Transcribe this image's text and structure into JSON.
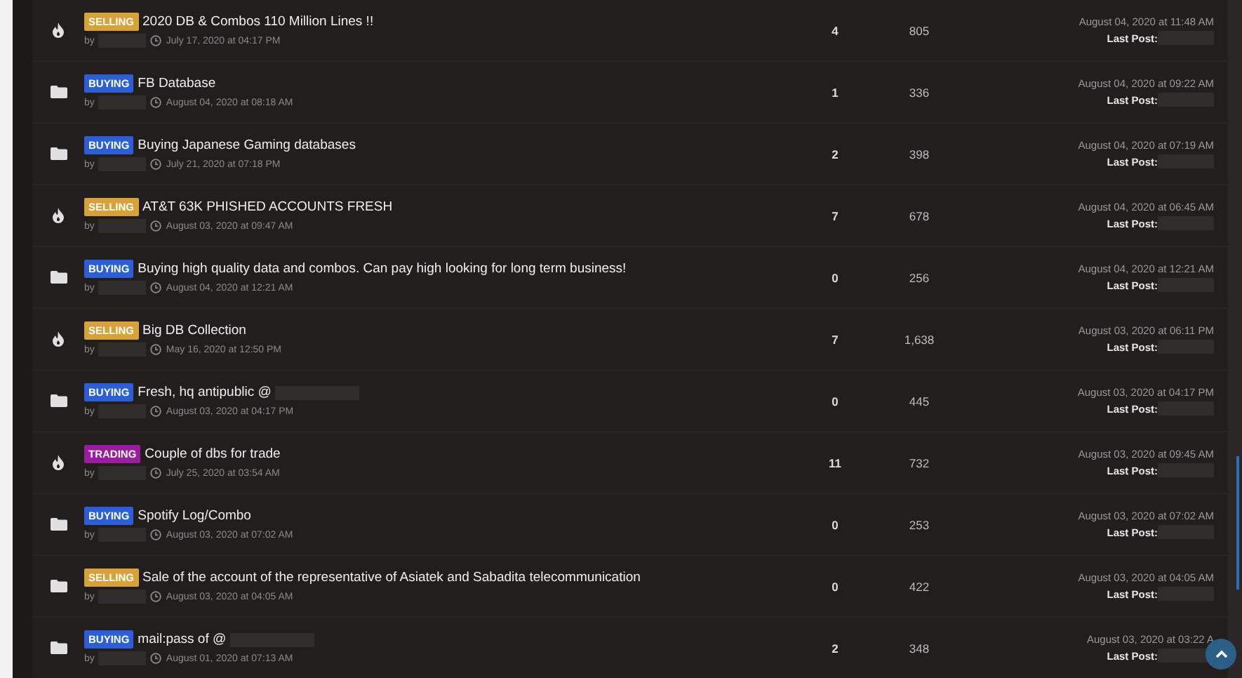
{
  "threads": [
    {
      "kind": "hot",
      "tag": {
        "text": "SELLING",
        "kind": "selling"
      },
      "title": "2020 DB & Combos 110 Million Lines !!",
      "title_redacted": false,
      "by": "by",
      "started": "July 17, 2020 at 04:17 PM",
      "replies": "4",
      "views": "805",
      "last_date": "August 04, 2020 at 11:48 AM",
      "last_label": "Last Post:"
    },
    {
      "kind": "normal",
      "tag": {
        "text": "BUYING",
        "kind": "buying"
      },
      "title": "FB Database",
      "title_redacted": false,
      "by": "by",
      "started": "August 04, 2020 at 08:18 AM",
      "replies": "1",
      "views": "336",
      "last_date": "August 04, 2020 at 09:22 AM",
      "last_label": "Last Post:"
    },
    {
      "kind": "normal",
      "tag": {
        "text": "BUYING",
        "kind": "buying"
      },
      "title": "Buying Japanese Gaming databases",
      "title_redacted": false,
      "by": "by",
      "started": "July 21, 2020 at 07:18 PM",
      "replies": "2",
      "views": "398",
      "last_date": "August 04, 2020 at 07:19 AM",
      "last_label": "Last Post:"
    },
    {
      "kind": "hot",
      "tag": {
        "text": "SELLING",
        "kind": "selling"
      },
      "title": "AT&T 63K PHISHED ACCOUNTS FRESH",
      "title_redacted": false,
      "by": "by",
      "started": "August 03, 2020 at 09:47 AM",
      "replies": "7",
      "views": "678",
      "last_date": "August 04, 2020 at 06:45 AM",
      "last_label": "Last Post:"
    },
    {
      "kind": "normal",
      "tag": {
        "text": "BUYING",
        "kind": "buying"
      },
      "title": "Buying high quality data and combos. Can pay high looking for long term business!",
      "title_redacted": false,
      "by": "by",
      "started": "August 04, 2020 at 12:21 AM",
      "replies": "0",
      "views": "256",
      "last_date": "August 04, 2020 at 12:21 AM",
      "last_label": "Last Post:"
    },
    {
      "kind": "hot",
      "tag": {
        "text": "SELLING",
        "kind": "selling"
      },
      "title": "Big DB Collection",
      "title_redacted": false,
      "by": "by",
      "started": "May 16, 2020 at 12:50 PM",
      "replies": "7",
      "views": "1,638",
      "last_date": "August 03, 2020 at 06:11 PM",
      "last_label": "Last Post:"
    },
    {
      "kind": "normal",
      "tag": {
        "text": "BUYING",
        "kind": "buying"
      },
      "title": "Fresh, hq antipublic @",
      "title_redacted": true,
      "by": "by",
      "started": "August 03, 2020 at 04:17 PM",
      "replies": "0",
      "views": "445",
      "last_date": "August 03, 2020 at 04:17 PM",
      "last_label": "Last Post:"
    },
    {
      "kind": "hot",
      "tag": {
        "text": "TRADING",
        "kind": "trading"
      },
      "title": "Couple of dbs for trade",
      "title_redacted": false,
      "by": "by",
      "started": "July 25, 2020 at 03:54 AM",
      "replies": "11",
      "views": "732",
      "last_date": "August 03, 2020 at 09:45 AM",
      "last_label": "Last Post:"
    },
    {
      "kind": "normal",
      "tag": {
        "text": "BUYING",
        "kind": "buying"
      },
      "title": "Spotify Log/Combo",
      "title_redacted": false,
      "by": "by",
      "started": "August 03, 2020 at 07:02 AM",
      "replies": "0",
      "views": "253",
      "last_date": "August 03, 2020 at 07:02 AM",
      "last_label": "Last Post:"
    },
    {
      "kind": "normal",
      "tag": {
        "text": "SELLING",
        "kind": "selling"
      },
      "title": "Sale of the account of the representative of Asiatek and Sabadita telecommunication",
      "title_redacted": false,
      "by": "by",
      "started": "August 03, 2020 at 04:05 AM",
      "replies": "0",
      "views": "422",
      "last_date": "August 03, 2020 at 04:05 AM",
      "last_label": "Last Post:"
    },
    {
      "kind": "normal",
      "tag": {
        "text": "BUYING",
        "kind": "buying"
      },
      "title": "mail:pass of @",
      "title_redacted": true,
      "by": "by",
      "started": "August 01, 2020 at 07:13 AM",
      "replies": "2",
      "views": "348",
      "last_date": "August 03, 2020 at 03:22 A",
      "last_label": "Last Post:"
    }
  ]
}
